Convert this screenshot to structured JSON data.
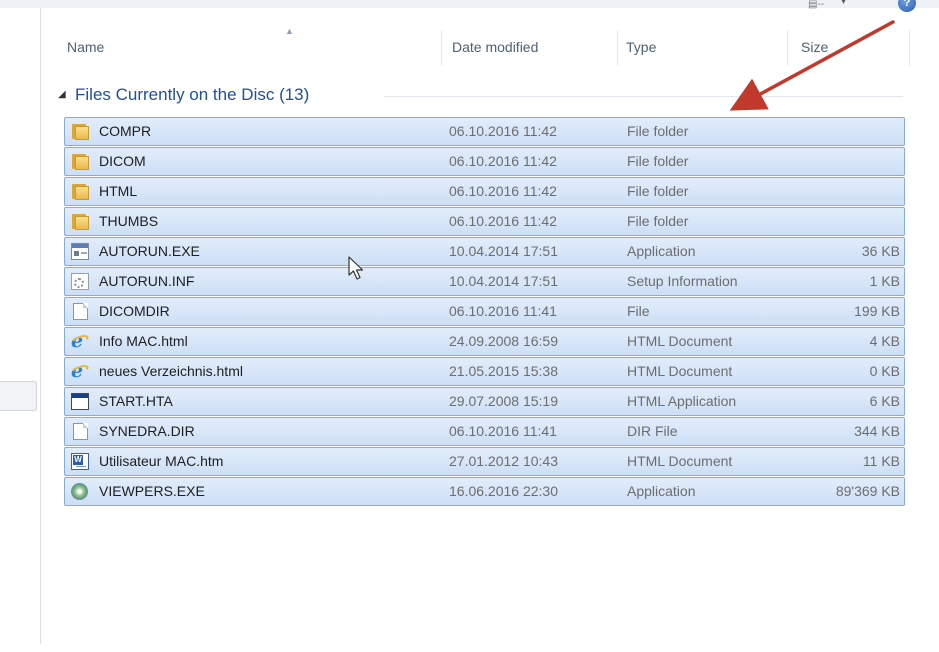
{
  "toolbar": {
    "view_icon": "view-options-icon",
    "chevron": "▾",
    "help_icon": "help-icon",
    "help_glyph": "?"
  },
  "columns": {
    "name": "Name",
    "date": "Date modified",
    "type": "Type",
    "size": "Size"
  },
  "group": {
    "title": "Files Currently on the Disc (13)"
  },
  "files": [
    {
      "name": "COMPR",
      "date": "06.10.2016 11:42",
      "type": "File folder",
      "size": "",
      "icon": "folder-icon"
    },
    {
      "name": "DICOM",
      "date": "06.10.2016 11:42",
      "type": "File folder",
      "size": "",
      "icon": "folder-icon"
    },
    {
      "name": "HTML",
      "date": "06.10.2016 11:42",
      "type": "File folder",
      "size": "",
      "icon": "folder-icon"
    },
    {
      "name": "THUMBS",
      "date": "06.10.2016 11:42",
      "type": "File folder",
      "size": "",
      "icon": "folder-icon"
    },
    {
      "name": "AUTORUN.EXE",
      "date": "10.04.2014 17:51",
      "type": "Application",
      "size": "36 KB",
      "icon": "application-icon"
    },
    {
      "name": "AUTORUN.INF",
      "date": "10.04.2014 17:51",
      "type": "Setup Information",
      "size": "1 KB",
      "icon": "setup-information-icon"
    },
    {
      "name": "DICOMDIR",
      "date": "06.10.2016 11:41",
      "type": "File",
      "size": "199 KB",
      "icon": "file-icon"
    },
    {
      "name": "Info MAC.html",
      "date": "24.09.2008 16:59",
      "type": "HTML Document",
      "size": "4 KB",
      "icon": "internet-explorer-icon"
    },
    {
      "name": "neues Verzeichnis.html",
      "date": "21.05.2015 15:38",
      "type": "HTML Document",
      "size": "0 KB",
      "icon": "internet-explorer-icon"
    },
    {
      "name": "START.HTA",
      "date": "29.07.2008 15:19",
      "type": "HTML Application",
      "size": "6 KB",
      "icon": "html-application-icon"
    },
    {
      "name": "SYNEDRA.DIR",
      "date": "06.10.2016 11:41",
      "type": "DIR File",
      "size": "344 KB",
      "icon": "file-icon"
    },
    {
      "name": "Utilisateur MAC.htm",
      "date": "27.01.2012 10:43",
      "type": "HTML Document",
      "size": "11 KB",
      "icon": "word-document-icon"
    },
    {
      "name": "VIEWPERS.EXE",
      "date": "16.06.2016 22:30",
      "type": "Application",
      "size": "89'369 KB",
      "icon": "viewer-application-icon"
    }
  ],
  "colors": {
    "selection_fill": "#cddff5",
    "selection_border": "#84acdd",
    "group_title": "#1f4fa3",
    "annotation_arrow": "#c0392b"
  }
}
